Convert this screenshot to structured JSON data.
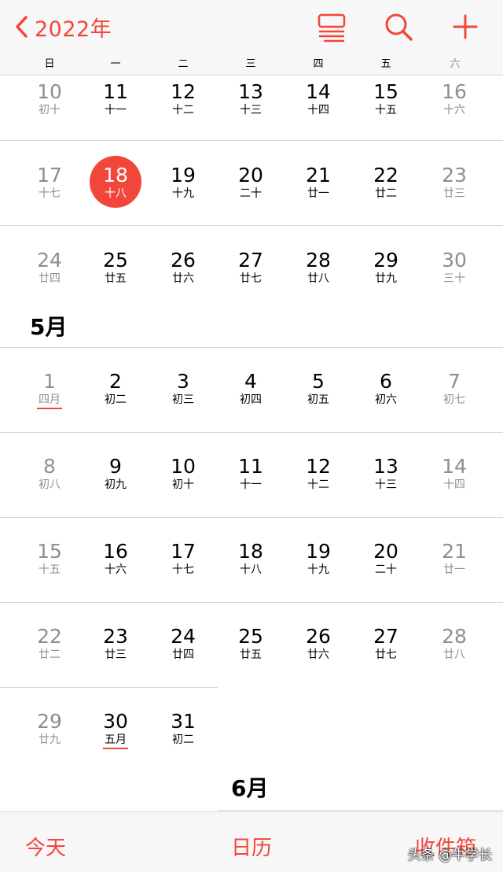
{
  "header": {
    "year_label": "2022年",
    "icons": [
      "list-view-icon",
      "search-icon",
      "add-icon"
    ]
  },
  "weekdays": [
    "日",
    "一",
    "二",
    "三",
    "四",
    "五",
    "六"
  ],
  "april_rows": [
    [
      [
        "10",
        "初十"
      ],
      [
        "11",
        "十一"
      ],
      [
        "12",
        "十二"
      ],
      [
        "13",
        "十三"
      ],
      [
        "14",
        "十四"
      ],
      [
        "15",
        "十五"
      ],
      [
        "16",
        "十六"
      ]
    ],
    [
      [
        "17",
        "十七"
      ],
      [
        "18",
        "十八"
      ],
      [
        "19",
        "十九"
      ],
      [
        "20",
        "二十"
      ],
      [
        "21",
        "廿一"
      ],
      [
        "22",
        "廿二"
      ],
      [
        "23",
        "廿三"
      ]
    ],
    [
      [
        "24",
        "廿四"
      ],
      [
        "25",
        "廿五"
      ],
      [
        "26",
        "廿六"
      ],
      [
        "27",
        "廿七"
      ],
      [
        "28",
        "廿八"
      ],
      [
        "29",
        "廿九"
      ],
      [
        "30",
        "三十"
      ]
    ]
  ],
  "today": "18",
  "may": {
    "label": "5月",
    "rows": [
      [
        [
          "1",
          "四月"
        ],
        [
          "2",
          "初二"
        ],
        [
          "3",
          "初三"
        ],
        [
          "4",
          "初四"
        ],
        [
          "5",
          "初五"
        ],
        [
          "6",
          "初六"
        ],
        [
          "7",
          "初七"
        ]
      ],
      [
        [
          "8",
          "初八"
        ],
        [
          "9",
          "初九"
        ],
        [
          "10",
          "初十"
        ],
        [
          "11",
          "十一"
        ],
        [
          "12",
          "十二"
        ],
        [
          "13",
          "十三"
        ],
        [
          "14",
          "十四"
        ]
      ],
      [
        [
          "15",
          "十五"
        ],
        [
          "16",
          "十六"
        ],
        [
          "17",
          "十七"
        ],
        [
          "18",
          "十八"
        ],
        [
          "19",
          "十九"
        ],
        [
          "20",
          "二十"
        ],
        [
          "21",
          "廿一"
        ]
      ],
      [
        [
          "22",
          "廿二"
        ],
        [
          "23",
          "廿三"
        ],
        [
          "24",
          "廿四"
        ],
        [
          "25",
          "廿五"
        ],
        [
          "26",
          "廿六"
        ],
        [
          "27",
          "廿七"
        ],
        [
          "28",
          "廿八"
        ]
      ],
      [
        [
          "29",
          "廿九"
        ],
        [
          "30",
          "五月"
        ],
        [
          "31",
          "初二"
        ]
      ]
    ]
  },
  "june": {
    "label": "6月"
  },
  "footer": {
    "today_label": "今天",
    "calendars_label": "日历",
    "inbox_label": "收件箱"
  },
  "watermark": "头条 @牛学长",
  "colors": {
    "accent": "#f2463b",
    "weekend": "#8e8e93"
  }
}
